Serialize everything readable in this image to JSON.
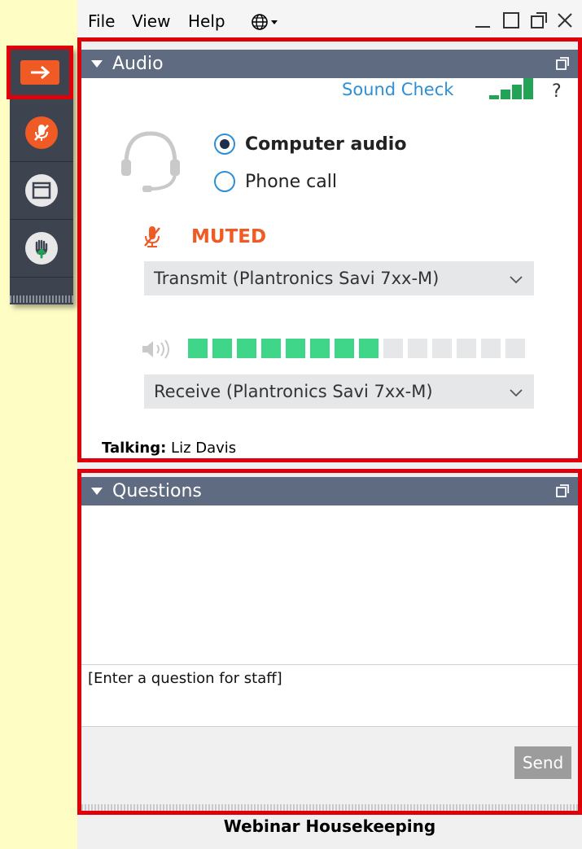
{
  "menu": {
    "file": "File",
    "view": "View",
    "help": "Help"
  },
  "audio": {
    "title": "Audio",
    "sound_check": "Sound Check",
    "help_mark": "?",
    "computer_audio": "Computer audio",
    "phone_call": "Phone call",
    "muted_label": "MUTED",
    "transmit_device": "Transmit (Plantronics Savi 7xx-M)",
    "receive_device": "Receive (Plantronics Savi 7xx-M)",
    "talking_label": "Talking:",
    "talking_name": "Liz Davis",
    "speaker_level": {
      "filled": 8,
      "total": 14
    }
  },
  "questions": {
    "title": "Questions",
    "placeholder": "[Enter a question for staff]",
    "send_label": "Send"
  },
  "footer": {
    "title": "Webinar Housekeeping"
  },
  "colors": {
    "accent_orange": "#f05a24",
    "panel_header": "#5e6b80",
    "link_blue": "#2e8fd6",
    "level_green": "#3fd68a",
    "highlight_red": "#e0000a"
  }
}
